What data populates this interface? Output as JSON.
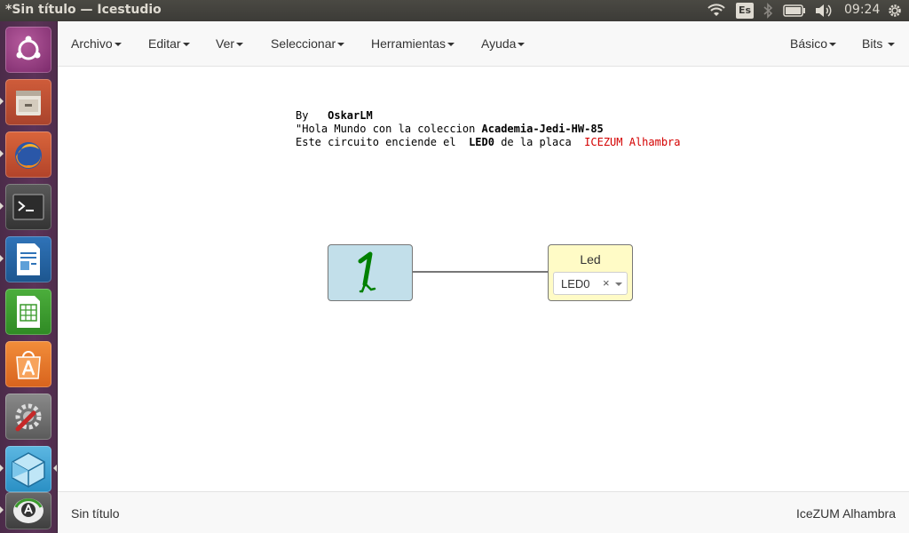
{
  "window": {
    "title": "*Sin título — Icestudio"
  },
  "system_tray": {
    "keyboard_layout": "Es",
    "clock": "09:24",
    "icons": [
      "wifi-icon",
      "keyboard-layout-icon",
      "bluetooth-icon",
      "battery-icon",
      "volume-icon",
      "settings-gear-icon"
    ]
  },
  "launcher": {
    "items": [
      "ubuntu-dash-icon",
      "files-icon",
      "firefox-icon",
      "terminal-icon",
      "writer-icon",
      "calc-icon",
      "software-center-icon",
      "system-settings-icon",
      "icestudio-icon",
      "update-manager-icon"
    ]
  },
  "menubar": {
    "items": [
      {
        "label": "Archivo"
      },
      {
        "label": "Editar"
      },
      {
        "label": "Ver"
      },
      {
        "label": "Seleccionar"
      },
      {
        "label": "Herramientas"
      },
      {
        "label": "Ayuda"
      }
    ],
    "right_items": [
      {
        "label": "Básico"
      },
      {
        "label": "Bits"
      }
    ]
  },
  "canvas": {
    "note": {
      "line1_prefix": "By   ",
      "line1_author": "OskarLM",
      "line2_prefix": "\"Hola Mundo con la coleccion ",
      "line2_collection": "Academia-Jedi-HW-85",
      "line3_prefix": "Este circuito enciende el  ",
      "line3_led": "LED0",
      "line3_middle": " de la placa  ",
      "line3_board": "ICEZUM Alhambra"
    },
    "constant_block": {
      "value": "1",
      "color": "#008000"
    },
    "led_block": {
      "title": "Led",
      "selected": "LED0",
      "clear": "×"
    }
  },
  "statusbar": {
    "file_name": "Sin título",
    "board": "IceZUM Alhambra"
  },
  "colors": {
    "launcher_bg": "#5c3358",
    "panel_bg": "#3c3b37",
    "constant_block_bg": "#c2dfea",
    "led_block_bg": "#fffbc6",
    "board_text": "#d40000"
  }
}
